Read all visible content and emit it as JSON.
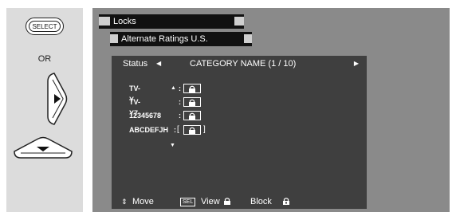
{
  "remote": {
    "select_label": "SELECT",
    "or_label": "OR"
  },
  "screen": {
    "header": "Locks",
    "subheader": "Alternate Ratings U.S.",
    "status_label": "Status",
    "category": "CATEGORY NAME (1 / 10)",
    "ratings": [
      {
        "label": "TV-Y"
      },
      {
        "label": "TV-Y7"
      },
      {
        "label": "12345678"
      },
      {
        "label": "ABCDEFJH"
      }
    ],
    "footer": {
      "move_label": "Move",
      "sel_badge": "SEL",
      "view_label": "View",
      "block_label": "Block"
    }
  },
  "colors": {
    "screen_bg": "#8a8a8a",
    "content_bg": "#3f3f3f",
    "bar_bg": "#111111",
    "remote_bg": "#dcdcdc"
  }
}
